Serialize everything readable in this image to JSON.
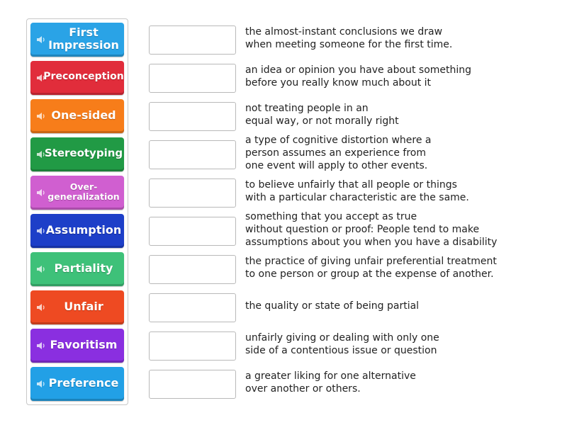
{
  "tiles": [
    {
      "label": "First\nImpression",
      "color": "#2aa3e6",
      "size": "f16"
    },
    {
      "label": "Preconception",
      "color": "#e12d3b",
      "size": "f14"
    },
    {
      "label": "One-sided",
      "color": "#f77d1a",
      "size": "f16"
    },
    {
      "label": "Stereotyping",
      "color": "#219a45",
      "size": "f15"
    },
    {
      "label": "Over-\ngeneralization",
      "color": "#d05fd0",
      "size": "f12"
    },
    {
      "label": "Assumption",
      "color": "#1d3fc8",
      "size": "f16"
    },
    {
      "label": "Partiality",
      "color": "#3ec179",
      "size": "f16"
    },
    {
      "label": "Unfair",
      "color": "#ee4a22",
      "size": "f16"
    },
    {
      "label": "Favoritism",
      "color": "#8a2fe0",
      "size": "f16"
    },
    {
      "label": "Preference",
      "color": "#22a0e6",
      "size": "f16"
    }
  ],
  "definitions": [
    "the almost-instant conclusions we draw\nwhen meeting someone for the first time.",
    "an idea or opinion you have about something\nbefore you really know much about it",
    "not treating people in an\nequal way, or not morally right",
    "a type of cognitive distortion where a\nperson assumes an experience from\none event will apply to other events.",
    "to believe unfairly that all people or things\nwith a particular characteristic are the same.",
    "something that you accept as true\nwithout question or proof: People tend to make\nassumptions about you when you have a disability",
    "the practice of giving unfair preferential treatment\nto one person or group at the expense of another.",
    "the quality or state of being partial",
    "unfairly giving or dealing with only one\nside of a contentious issue or question",
    "a greater liking for one alternative\nover another or others."
  ],
  "icons": {
    "tile_icon": "speaker-icon"
  }
}
